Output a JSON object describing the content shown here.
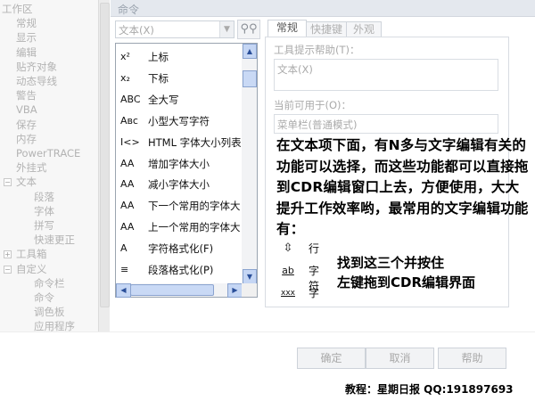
{
  "tree": {
    "items": [
      {
        "text": "工作区",
        "level": 0
      },
      {
        "text": "常规",
        "level": 1
      },
      {
        "text": "显示",
        "level": 1
      },
      {
        "text": "编辑",
        "level": 1
      },
      {
        "text": "贴齐对象",
        "level": 1
      },
      {
        "text": "动态导线",
        "level": 1
      },
      {
        "text": "警告",
        "level": 1
      },
      {
        "text": "VBA",
        "level": 1
      },
      {
        "text": "保存",
        "level": 1
      },
      {
        "text": "内存",
        "level": 1
      },
      {
        "text": "PowerTRACE",
        "level": 1
      },
      {
        "text": "外挂式",
        "level": 1
      },
      {
        "text": "文本",
        "level": 1
      },
      {
        "text": "段落",
        "level": 2
      },
      {
        "text": "字体",
        "level": 2
      },
      {
        "text": "拼写",
        "level": 2
      },
      {
        "text": "快速更正",
        "level": 2
      },
      {
        "text": "工具箱",
        "level": 1
      },
      {
        "text": "自定义",
        "level": 1
      },
      {
        "text": "命令栏",
        "level": 2
      },
      {
        "text": "命令",
        "level": 2
      },
      {
        "text": "调色板",
        "level": 2
      },
      {
        "text": "应用程序",
        "level": 2
      }
    ]
  },
  "header": {
    "title": "命令"
  },
  "category_select": {
    "value": "文本(X)"
  },
  "commands": [
    {
      "icon": "x²",
      "label": "上标"
    },
    {
      "icon": "x₂",
      "label": "下标"
    },
    {
      "icon": "ABC",
      "label": "全大写"
    },
    {
      "icon": "Aʙᴄ",
      "label": "小型大写字符"
    },
    {
      "icon": "I<>",
      "label": "HTML 字体大小列表"
    },
    {
      "icon": "AA",
      "label": "增加字体大小"
    },
    {
      "icon": "AA",
      "label": "减小字体大小"
    },
    {
      "icon": "AA",
      "label": "下一个常用的字体大"
    },
    {
      "icon": "AA",
      "label": "上一个常用的字体大"
    },
    {
      "icon": "A",
      "label": "字符格式化(F)"
    },
    {
      "icon": "≡",
      "label": "段落格式化(P)"
    }
  ],
  "tabs": [
    {
      "label": "常规"
    },
    {
      "label": "快捷键"
    },
    {
      "label": "外观"
    }
  ],
  "props": {
    "tooltip_label": "工具提示帮助(T)：",
    "tooltip_value": "文本(X)",
    "available_label": "当前可用于(O)：",
    "available_value": "菜单栏(普通模式)"
  },
  "annotation": {
    "main_text": "在文本项下面，有N多与文字编辑有关的功能可以选择，而这些功能都可以直接拖到CDR编辑窗口上去，方便使用，大大提升工作效率哟，最常用的文字编辑功能有：",
    "tools": [
      {
        "icon": "⇥⇤",
        "label": "行"
      },
      {
        "icon": "ab",
        "label": "字符"
      },
      {
        "icon": "xxx",
        "label": "字"
      }
    ],
    "hint_line1": "找到这三个并按住",
    "hint_line2": "左键拖到CDR编辑界面"
  },
  "buttons": {
    "ok": "确定",
    "cancel": "取消",
    "help": "帮助"
  },
  "credit": "教程：星期日报 QQ:191897693"
}
